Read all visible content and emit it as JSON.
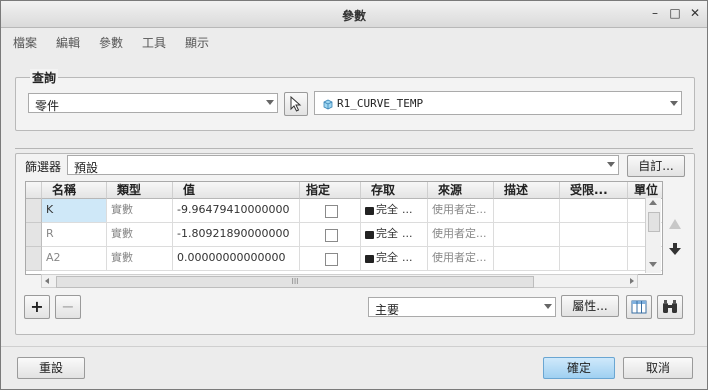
{
  "window": {
    "title": "參數",
    "minimize": "–",
    "maximize": "□",
    "close": "✕"
  },
  "menu": [
    "檔案",
    "編輯",
    "參數",
    "工具",
    "顯示"
  ],
  "query": {
    "legend": "查詢",
    "lookin_value": "零件",
    "object_value": "R1_CURVE_TEMP",
    "icons": {
      "select": "arrow-cursor-icon",
      "object": "part-cube-icon"
    }
  },
  "filter": {
    "label": "篩選器",
    "value": "預設",
    "customize": "自訂..."
  },
  "table": {
    "columns": [
      "名稱",
      "類型",
      "值",
      "指定",
      "存取",
      "來源",
      "描述",
      "受限...",
      "單位"
    ],
    "rows": [
      {
        "name": "K",
        "type": "實數",
        "value": "-9.96479410000000",
        "designated": false,
        "access": "完全",
        "access_more": "...",
        "source": "使用者定...",
        "description": "",
        "restricted": "",
        "unit": ""
      },
      {
        "name": "R",
        "type": "實數",
        "value": "-1.80921890000000",
        "designated": false,
        "access": "完全",
        "access_more": "...",
        "source": "使用者定...",
        "description": "",
        "restricted": "",
        "unit": ""
      },
      {
        "name": "A2",
        "type": "實數",
        "value": "0.00000000000000",
        "designated": false,
        "access": "完全",
        "access_more": "...",
        "source": "使用者定...",
        "description": "",
        "restricted": "",
        "unit": ""
      }
    ]
  },
  "toolbar": {
    "add": "+",
    "remove": "−",
    "main_value": "主要",
    "properties": "屬性...",
    "scroll_thumb_grip": "III"
  },
  "footer": {
    "reset": "重設",
    "ok": "確定",
    "cancel": "取消"
  },
  "colors": {
    "accent": "#9fd0f1",
    "selected_cell": "#cfe8f8"
  }
}
